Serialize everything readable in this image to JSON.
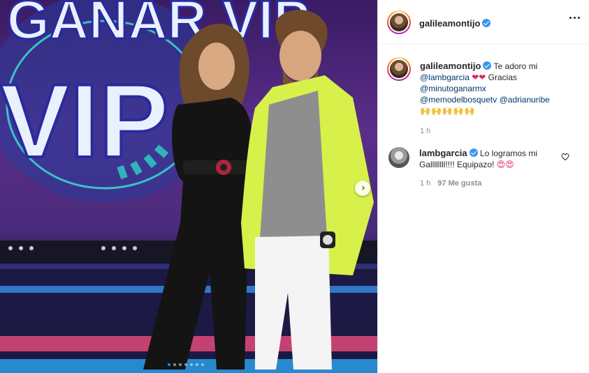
{
  "post": {
    "username": "galileamontijo",
    "verified": true,
    "carousel": {
      "slides": 7,
      "active_index": 0
    },
    "next_icon": "chevron-right-icon",
    "more_icon": "more-options-icon",
    "backdrop_sign": "GANAR VIP"
  },
  "caption": {
    "username": "galileamontijo",
    "text_1": "Te adoro mi",
    "mention_1": "@lambgarcia",
    "hearts": "❤❤",
    "text_2": "Gracias",
    "mention_2": "@minutoganarmx",
    "mention_3": "@memodelbosquetv",
    "mention_4": "@adrianuribe",
    "emoji_row": "🙌🙌🙌🙌🙌",
    "time": "1 h"
  },
  "comment": {
    "username": "lambgarcia",
    "verified": true,
    "text_1": "Lo logramos mi",
    "text_2": "Gallllllll!!!! Equipazo!",
    "emojis": "😍😍",
    "time": "1 h",
    "likes": "97 Me gusta",
    "like_icon": "heart-outline-icon"
  },
  "colors": {
    "verified": "#3897f0",
    "mention": "#00376b",
    "muted": "#8e8e8e",
    "jacket": "#d8f04a",
    "backdrop": "#5a2e8a"
  }
}
